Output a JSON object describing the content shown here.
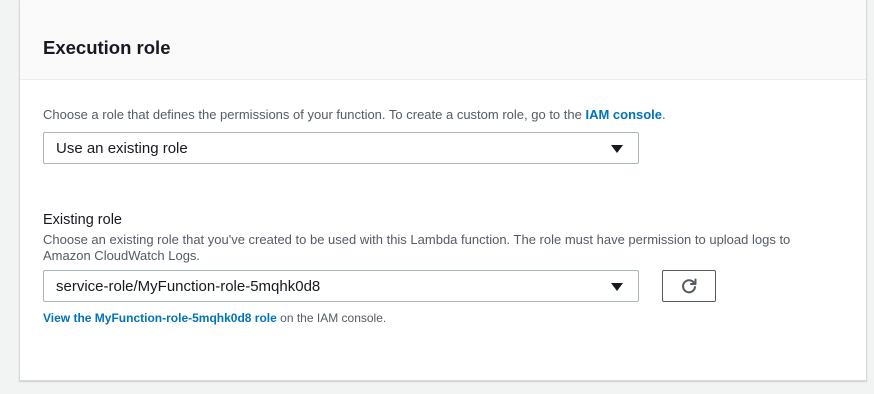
{
  "section": {
    "title": "Execution role"
  },
  "role_choice": {
    "description_prefix": "Choose a role that defines the permissions of your function. To create a custom role, go to the ",
    "iam_link": "IAM console",
    "description_suffix": ".",
    "selected_value": "Use an existing role"
  },
  "existing_role": {
    "label": "Existing role",
    "description_line1": "Choose an existing role that you've created to be used with this Lambda function. The role must have permission to upload logs to",
    "description_line2": "Amazon CloudWatch Logs.",
    "selected_value": "service-role/MyFunction-role-5mqhk0d8",
    "refresh_icon": "refresh-icon",
    "view_link": "View the MyFunction-role-5mqhk0d8 role",
    "view_suffix": " on the IAM console."
  },
  "colors": {
    "link": "#0073bb",
    "text": "#16191f",
    "secondary_text": "#545b64",
    "border": "#aab7b8"
  }
}
